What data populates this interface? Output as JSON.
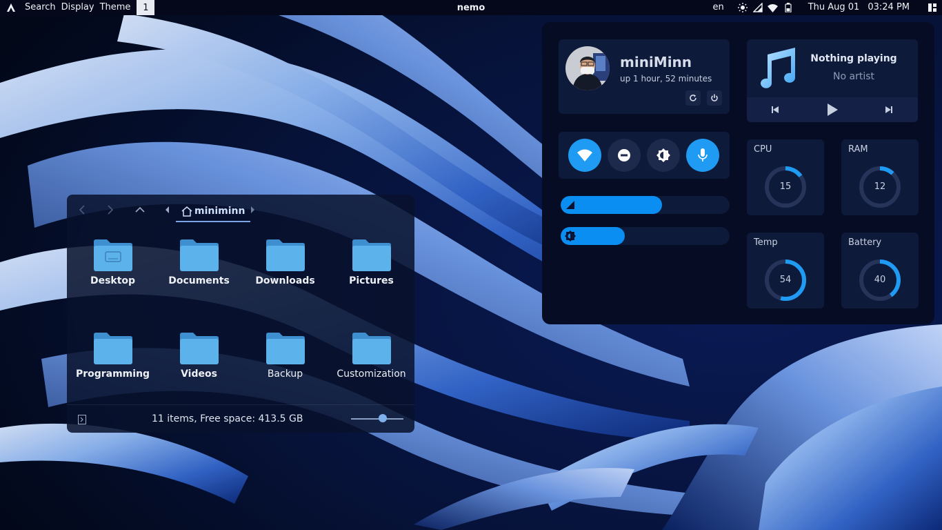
{
  "topbar": {
    "menu": [
      "Search",
      "Display",
      "Theme"
    ],
    "workspace": "1",
    "active_window": "nemo",
    "keyboard_layout": "en",
    "date": "Thu Aug 01",
    "time": "03:24 PM",
    "status_icons": [
      "brightness-icon",
      "signal-icon",
      "wifi-icon",
      "battery-icon",
      "layout-icon"
    ]
  },
  "file_manager": {
    "path": "miniminn",
    "items": [
      {
        "label": "Desktop",
        "bold": true,
        "icon": "folder-desktop-icon"
      },
      {
        "label": "Documents",
        "bold": true,
        "icon": "folder-icon"
      },
      {
        "label": "Downloads",
        "bold": true,
        "icon": "folder-icon"
      },
      {
        "label": "Pictures",
        "bold": true,
        "icon": "folder-icon"
      },
      {
        "label": "Programming",
        "bold": true,
        "icon": "folder-icon"
      },
      {
        "label": "Videos",
        "bold": true,
        "icon": "folder-icon"
      },
      {
        "label": "Backup",
        "bold": false,
        "icon": "folder-icon"
      },
      {
        "label": "Customization",
        "bold": false,
        "icon": "folder-icon"
      }
    ],
    "status": "11 items, Free space: 413.5 GB",
    "zoom_level": 0.5
  },
  "control_center": {
    "user": {
      "name": "miniMinn",
      "uptime": "up 1 hour, 52 minutes"
    },
    "toggles": [
      {
        "name": "wifi",
        "on": true,
        "icon": "wifi-icon"
      },
      {
        "name": "do-not-disturb",
        "on": false,
        "icon": "dnd-icon"
      },
      {
        "name": "brightness",
        "on": false,
        "icon": "brightness-icon"
      },
      {
        "name": "microphone",
        "on": true,
        "icon": "mic-icon"
      }
    ],
    "volume": 0.6,
    "brightness": 0.38,
    "media": {
      "title": "Nothing playing",
      "artist": "No artist"
    },
    "stats": [
      {
        "label": "CPU",
        "value": "15"
      },
      {
        "label": "RAM",
        "value": "12"
      },
      {
        "label": "Temp",
        "value": "54"
      },
      {
        "label": "Battery",
        "value": "40"
      }
    ],
    "accent": "#1f9bf3"
  }
}
